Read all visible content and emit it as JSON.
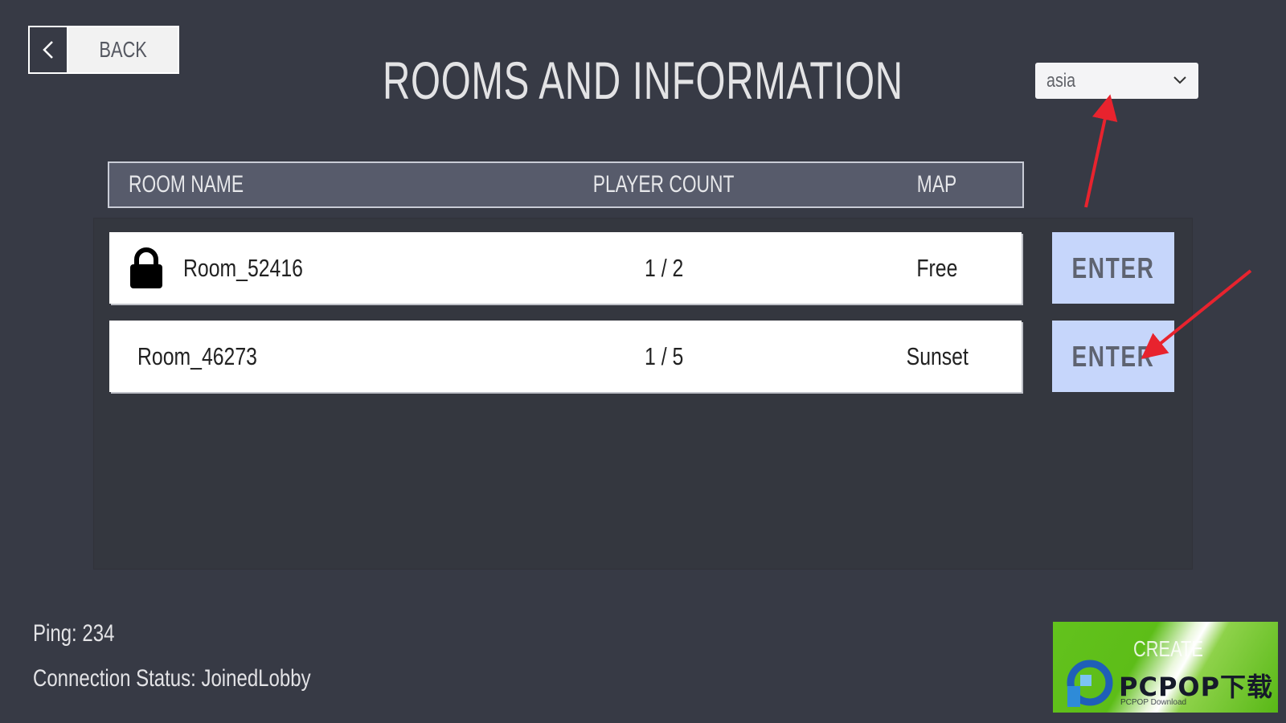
{
  "header": {
    "back_label": "BACK",
    "back_icon": "<",
    "title": "ROOMS AND INFORMATION"
  },
  "region_select": {
    "selected": "asia"
  },
  "table": {
    "columns": [
      "ROOM NAME",
      "PLAYER COUNT",
      "MAP"
    ],
    "rows": [
      {
        "room_name": "Room_52416",
        "players": "1 / 2",
        "map": "Free",
        "locked": true,
        "enter_label": "ENTER"
      },
      {
        "room_name": "Room_46273",
        "players": "1 / 5",
        "map": "Sunset",
        "locked": false,
        "enter_label": "ENTER"
      }
    ]
  },
  "status": {
    "ping": "Ping: 234",
    "connection": "Connection Status: JoinedLobby"
  },
  "create_button": {
    "label": "CREATE"
  },
  "watermark": {
    "text": "PCPOP下载",
    "sub": "PCPOP Download"
  },
  "colors": {
    "background": "#373a45",
    "header_bg": "#575b6b",
    "enter_bg": "#c6d6fb",
    "create_bg": "#63c21d",
    "annotation_arrow": "#e8232e"
  }
}
